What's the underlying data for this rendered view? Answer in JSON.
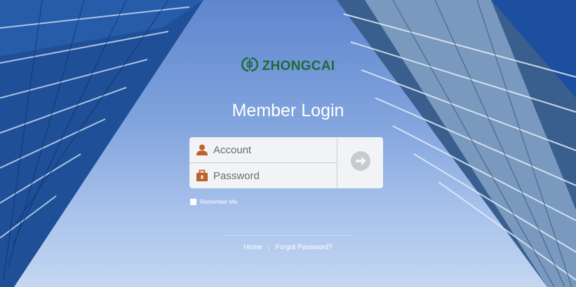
{
  "brand": {
    "name": "ZHONGCAI",
    "color": "#1f6a3a"
  },
  "title": "Member Login",
  "form": {
    "account_placeholder": "Account",
    "password_placeholder": "Password",
    "account_icon": "user-icon",
    "password_icon": "briefcase-icon",
    "submit_icon": "arrow-right-icon",
    "icon_color": "#c0602a"
  },
  "remember_label": "Remember Me",
  "footer": {
    "home_label": "Home",
    "separator": "|",
    "forgot_label": "Forgot Password?"
  }
}
